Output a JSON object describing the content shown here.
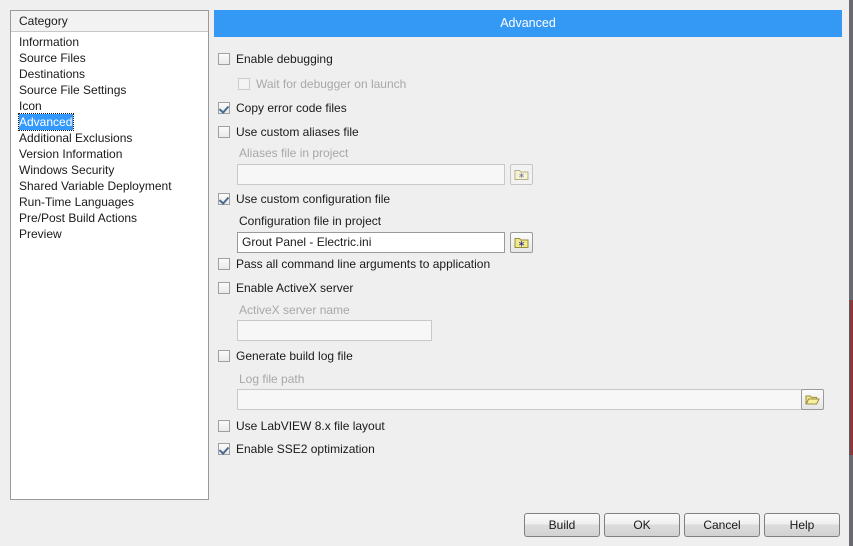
{
  "window": {
    "background_color": "#efefef"
  },
  "category_panel": {
    "header": "Category",
    "items": [
      {
        "label": "Information",
        "selected": false
      },
      {
        "label": "Source Files",
        "selected": false
      },
      {
        "label": "Destinations",
        "selected": false
      },
      {
        "label": "Source File Settings",
        "selected": false
      },
      {
        "label": "Icon",
        "selected": false
      },
      {
        "label": "Advanced",
        "selected": true
      },
      {
        "label": "Additional Exclusions",
        "selected": false
      },
      {
        "label": "Version Information",
        "selected": false
      },
      {
        "label": "Windows Security",
        "selected": false
      },
      {
        "label": "Shared Variable Deployment",
        "selected": false
      },
      {
        "label": "Run-Time Languages",
        "selected": false
      },
      {
        "label": "Pre/Post Build Actions",
        "selected": false
      },
      {
        "label": "Preview",
        "selected": false
      }
    ],
    "selection_color": "#3399ff"
  },
  "main_panel": {
    "title": "Advanced",
    "title_bar_color": "#3498f5",
    "options": {
      "enable_debugging": {
        "label": "Enable debugging",
        "checked": false,
        "enabled": true
      },
      "wait_for_debugger": {
        "label": "Wait for debugger on launch",
        "checked": false,
        "enabled": false
      },
      "copy_error_code_files": {
        "label": "Copy error code files",
        "checked": true,
        "enabled": true
      },
      "use_custom_aliases_file": {
        "label": "Use custom aliases file",
        "checked": false,
        "enabled": true
      },
      "use_custom_configuration_file": {
        "label": "Use custom configuration file",
        "checked": true,
        "enabled": true
      },
      "pass_all_command_line_args": {
        "label": "Pass all command line arguments to application",
        "checked": false,
        "enabled": true
      },
      "enable_activex_server": {
        "label": "Enable ActiveX server",
        "checked": false,
        "enabled": true
      },
      "generate_build_log_file": {
        "label": "Generate build log file",
        "checked": false,
        "enabled": true
      },
      "use_labview_8x_file_layout": {
        "label": "Use LabVIEW 8.x file layout",
        "checked": false,
        "enabled": true
      },
      "enable_sse2_optimization": {
        "label": "Enable SSE2 optimization",
        "checked": true,
        "enabled": true
      }
    },
    "fields": {
      "aliases_file": {
        "label": "Aliases file in project",
        "value": "",
        "enabled": false,
        "browse_icon": "folder-asterisk-icon"
      },
      "configuration_file": {
        "label": "Configuration file in project",
        "value": "Grout Panel - Electric.ini",
        "enabled": true,
        "browse_icon": "folder-asterisk-icon"
      },
      "activex_server_name": {
        "label": "ActiveX server name",
        "value": "",
        "enabled": false
      },
      "log_file_path": {
        "label": "Log file path",
        "value": "",
        "enabled": false,
        "browse_icon": "folder-open-icon"
      }
    }
  },
  "footer": {
    "buttons": [
      {
        "label": "Build"
      },
      {
        "label": "OK"
      },
      {
        "label": "Cancel"
      },
      {
        "label": "Help"
      }
    ]
  }
}
